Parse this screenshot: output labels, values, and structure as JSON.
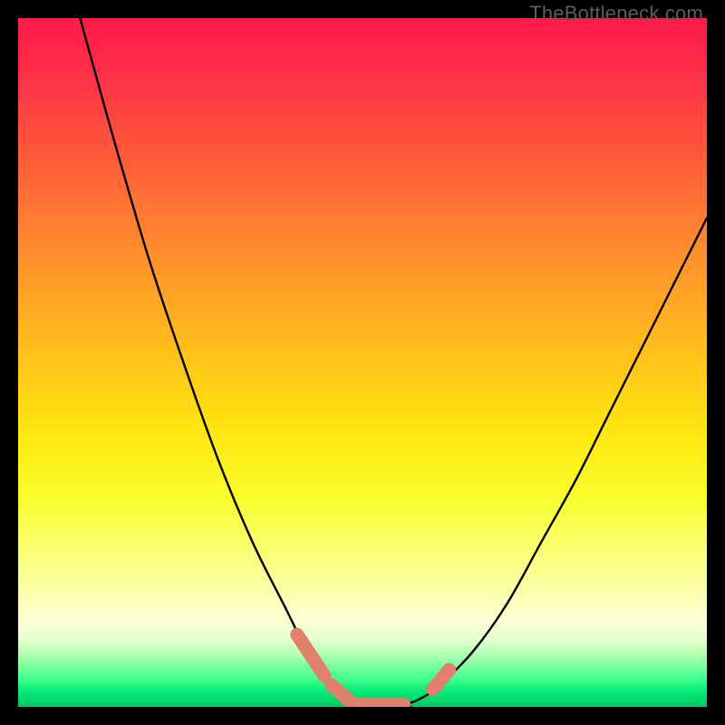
{
  "watermark": "TheBottleneck.com",
  "colors": {
    "frame": "#000000",
    "curve": "#000000",
    "marker": "#e0806d",
    "gradient_top": "#ff1a4b",
    "gradient_bottom": "#00c862"
  },
  "chart_data": {
    "type": "line",
    "title": "",
    "xlabel": "",
    "ylabel": "",
    "xlim": [
      0,
      100
    ],
    "ylim": [
      0,
      100
    ],
    "grid": false,
    "legend": false,
    "note": "Axis values are estimated from pixel positions; the image has no numeric tick labels. y is approximate bottleneck percent (0 at bottom, 100 at top).",
    "series": [
      {
        "name": "left-branch",
        "x": [
          9,
          14,
          19,
          24,
          29,
          34,
          39,
          42,
          45,
          48,
          50
        ],
        "y": [
          100,
          82,
          65,
          50,
          36,
          24,
          14,
          8,
          4,
          1,
          0
        ]
      },
      {
        "name": "right-branch",
        "x": [
          55,
          58,
          61,
          66,
          71,
          76,
          81,
          86,
          91,
          96,
          100
        ],
        "y": [
          0,
          1,
          3,
          8,
          15,
          24,
          33,
          43,
          53,
          63,
          71
        ]
      }
    ],
    "bottom_plateau": {
      "x_start": 48,
      "x_end": 57,
      "y": 0
    },
    "markers": [
      {
        "kind": "segment",
        "x1": 40.5,
        "y1": 10.5,
        "x2": 44.5,
        "y2": 4.5
      },
      {
        "kind": "segment",
        "x1": 45.5,
        "y1": 3.2,
        "x2": 48.0,
        "y2": 1.0
      },
      {
        "kind": "segment",
        "x1": 49.0,
        "y1": 0.4,
        "x2": 56.0,
        "y2": 0.4
      },
      {
        "kind": "segment",
        "x1": 60.2,
        "y1": 2.6,
        "x2": 62.6,
        "y2": 5.4
      }
    ]
  }
}
